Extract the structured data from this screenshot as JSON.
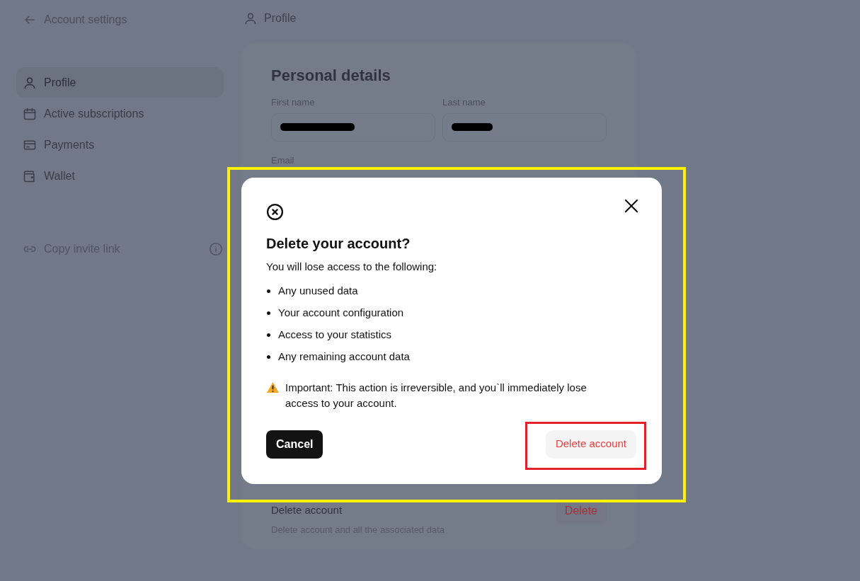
{
  "header": {
    "back_label": "Account settings",
    "page_title": "Profile"
  },
  "sidebar": {
    "items": [
      {
        "label": "Profile",
        "kind": "user",
        "selected": true
      },
      {
        "label": "Active subscriptions",
        "kind": "calendar",
        "selected": false
      },
      {
        "label": "Payments",
        "kind": "card",
        "selected": false
      },
      {
        "label": "Wallet",
        "kind": "wallet",
        "selected": false
      }
    ],
    "invite": {
      "label": "Copy invite link"
    }
  },
  "personal_details": {
    "title": "Personal details",
    "fields": [
      {
        "label": "First name",
        "redacted": true
      },
      {
        "label": "Last name",
        "redacted": true
      }
    ],
    "email_label": "Email"
  },
  "delete_section": {
    "title": "Delete account",
    "description": "Delete account and all the associated data",
    "button": "Delete"
  },
  "modal": {
    "title": "Delete your account?",
    "intro": "You will lose access to the following:",
    "items": [
      "Any unused data",
      "Your account configuration",
      "Access to your statistics",
      "Any remaining account data"
    ],
    "warning": "Important: This action is irreversible, and you`ll immediately lose access to your account.",
    "cancel": "Cancel",
    "confirm": "Delete account"
  },
  "highlights": [
    {
      "kind": "dialog",
      "color": "#fff200"
    },
    {
      "kind": "confirm",
      "color": "#e5202a"
    }
  ]
}
